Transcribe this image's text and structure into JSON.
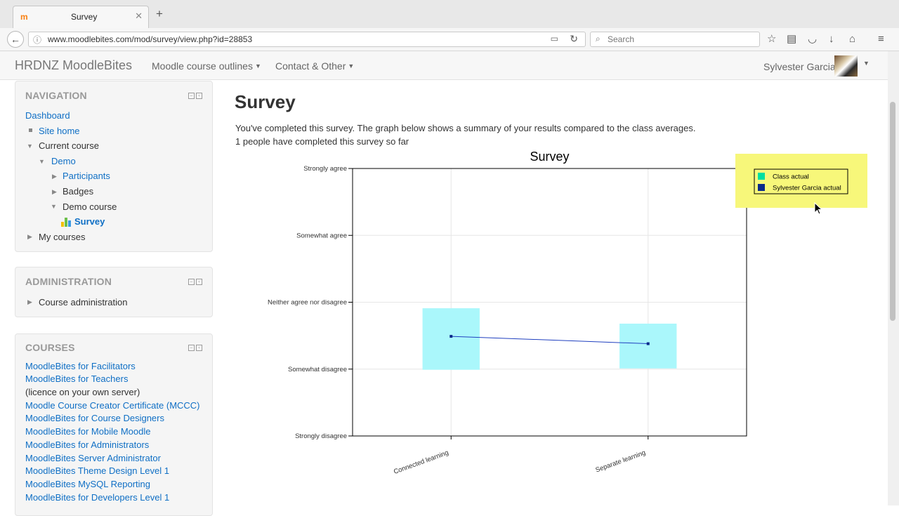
{
  "browser": {
    "tab_title": "Survey",
    "url": "www.moodlebites.com/mod/survey/view.php?id=28853",
    "search_placeholder": "Search"
  },
  "header": {
    "brand": "HRDNZ MoodleBites",
    "menus": [
      "Moodle course outlines",
      "Contact & Other"
    ],
    "user_name": "Sylvester Garcia"
  },
  "navigation": {
    "title": "NAVIGATION",
    "dashboard": "Dashboard",
    "site_home": "Site home",
    "current_course": "Current course",
    "demo": "Demo",
    "participants": "Participants",
    "badges": "Badges",
    "demo_course": "Demo course",
    "survey": "Survey",
    "my_courses": "My courses"
  },
  "administration": {
    "title": "ADMINISTRATION",
    "course_admin": "Course administration"
  },
  "courses": {
    "title": "COURSES",
    "items": [
      "MoodleBites for Facilitators",
      "MoodleBites for Teachers",
      "(licence on your own server)",
      "Moodle Course Creator Certificate (MCCC)",
      "MoodleBites for Course Designers",
      "MoodleBites for Mobile Moodle",
      "MoodleBites for Administrators",
      "MoodleBites Server Administrator",
      "MoodleBites Theme Design Level 1",
      "MoodleBites MySQL Reporting",
      "MoodleBites for Developers Level 1"
    ]
  },
  "main": {
    "title": "Survey",
    "intro_line1": "You've completed this survey. The graph below shows a summary of your results compared to the class averages.",
    "intro_line2": "1 people have completed this survey so far"
  },
  "chart_data": {
    "type": "bar",
    "title": "Survey",
    "categories": [
      "Connected learning",
      "Separate learning"
    ],
    "y_levels": [
      "Strongly disagree",
      "Somewhat disagree",
      "Neither agree nor disagree",
      "Somewhat agree",
      "Strongly agree"
    ],
    "ylim": [
      1,
      5
    ],
    "series": [
      {
        "name": "Class actual",
        "style": "range-box",
        "low": [
          1.99,
          2.01
        ],
        "high": [
          2.91,
          2.68
        ],
        "color": "#aaf7fb",
        "legend_color": "#00e0a0"
      },
      {
        "name": "Sylvester Garcia actual",
        "style": "line",
        "values": [
          2.49,
          2.38
        ],
        "color": "#1f3fbf",
        "legend_color": "#0a2a8a"
      }
    ],
    "grid": true,
    "legend_position": "top-right"
  }
}
